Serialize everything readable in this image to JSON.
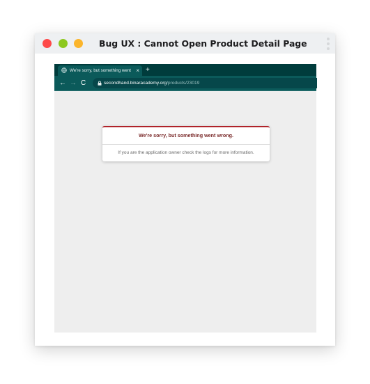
{
  "window": {
    "title": "Bug UX : Cannot Open Product Detail Page",
    "buttons": {
      "close_color": "#fe4a4a",
      "minimize_color": "#8dc81f",
      "maximize_color": "#fbb52c"
    },
    "menu_icon": "kebab-vertical-icon"
  },
  "browser": {
    "tab": {
      "title": "We're sorry, but something went",
      "icon": "globe-icon",
      "close_symbol": "×"
    },
    "new_tab_symbol": "+",
    "nav": {
      "back_symbol": "←",
      "forward_symbol": "→",
      "reload_symbol": "C"
    },
    "address": {
      "host": "secondhand.binaracademy.org",
      "path": "/products/23019",
      "icon": "lock-icon"
    },
    "theme_color": "#0b5a5a"
  },
  "error": {
    "heading": "We're sorry, but something went wrong.",
    "message": "If you are the application owner check the logs for more information.",
    "accent_color": "#b0232a"
  }
}
